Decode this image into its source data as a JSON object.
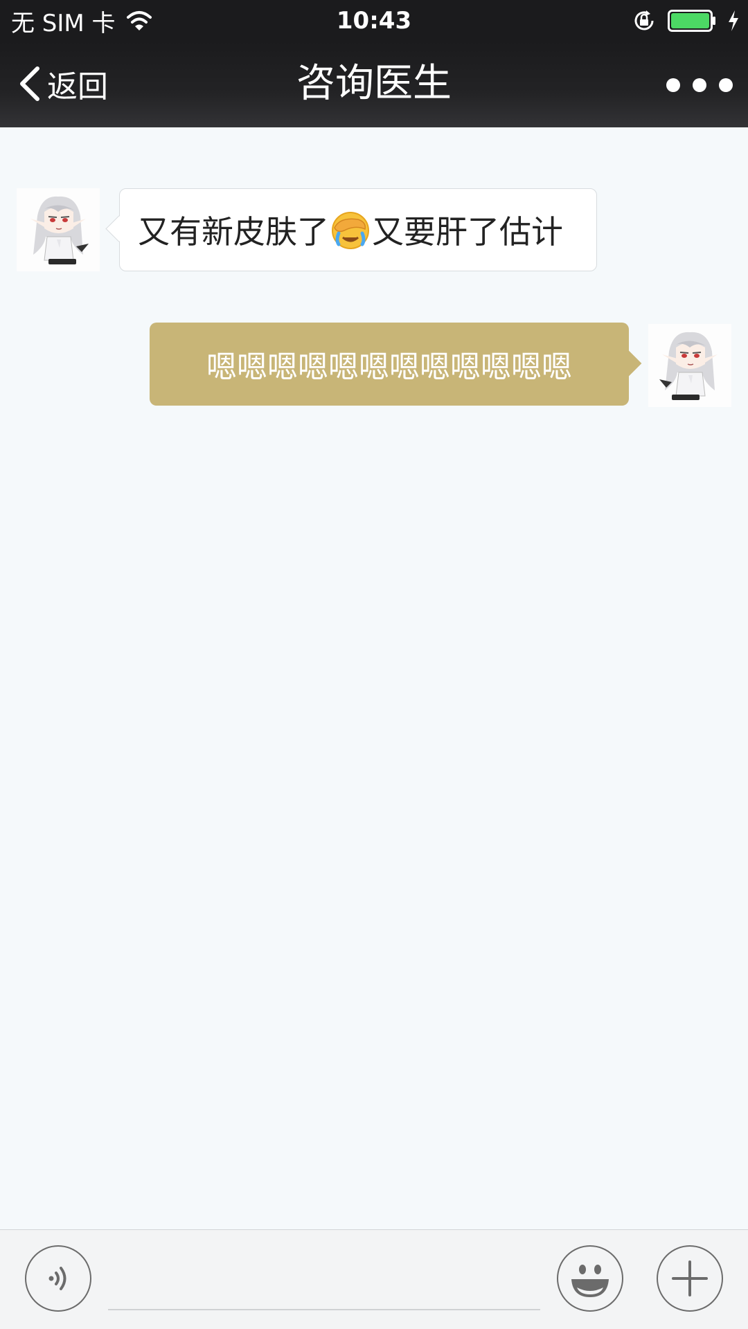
{
  "status_bar": {
    "carrier": "无 SIM 卡",
    "time": "10:43",
    "battery_color": "#4cd964"
  },
  "nav": {
    "back_label": "返回",
    "title": "咨询医生"
  },
  "messages": [
    {
      "side": "left",
      "text_before_emoji": "又有新皮肤了",
      "emoji": "face-palm-crying-emoji",
      "text_after_emoji": "又要肝了估计"
    },
    {
      "side": "right",
      "text": "嗯嗯嗯嗯嗯嗯嗯嗯嗯嗯嗯嗯"
    }
  ],
  "input_bar": {
    "message_value": "",
    "placeholder": ""
  },
  "colors": {
    "sent_bubble": "#c8b577",
    "chat_background": "#f5f9fb",
    "nav_background": "#1b1b1d"
  }
}
